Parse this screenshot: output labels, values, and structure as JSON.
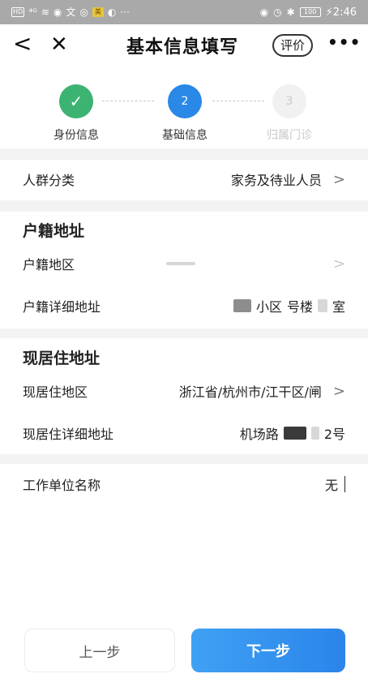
{
  "status_bar": {
    "left_badges": [
      "HD",
      "⁴ᴳ",
      "≋",
      "◉",
      "文",
      "◎",
      "美",
      "◐",
      "···"
    ],
    "right_icons": [
      "◉",
      "◷",
      "✱"
    ],
    "battery": "100",
    "time": "⚡2:46"
  },
  "nav": {
    "back_glyph": "<",
    "close_glyph": "✕",
    "title": "基本信息填写",
    "rate_label": "评价",
    "more_glyph": "•••"
  },
  "stepper": {
    "steps": [
      {
        "label": "身份信息",
        "mark": "✓",
        "state": "done"
      },
      {
        "label": "基础信息",
        "mark": "2",
        "state": "active"
      },
      {
        "label": "归属门诊",
        "mark": "3",
        "state": "todo"
      }
    ]
  },
  "crowd": {
    "label": "人群分类",
    "value": "家务及待业人员"
  },
  "household": {
    "section_title": "户籍地址",
    "region_label": "户籍地区",
    "region_value": "",
    "detail_label": "户籍详细地址",
    "detail_parts": [
      "小区",
      "号楼",
      "室"
    ]
  },
  "residence": {
    "section_title": "现居住地址",
    "region_label": "现居住地区",
    "region_value": "浙江省/杭州市/江干区/闸",
    "detail_label": "现居住详细地址",
    "detail_parts": [
      "机场路",
      "2号"
    ]
  },
  "work": {
    "label": "工作单位名称",
    "value": "无"
  },
  "buttons": {
    "prev": "上一步",
    "next": "下一步"
  },
  "colors": {
    "accent": "#2a88e6",
    "done": "#3cb371",
    "todo": "#f1f1f1"
  }
}
